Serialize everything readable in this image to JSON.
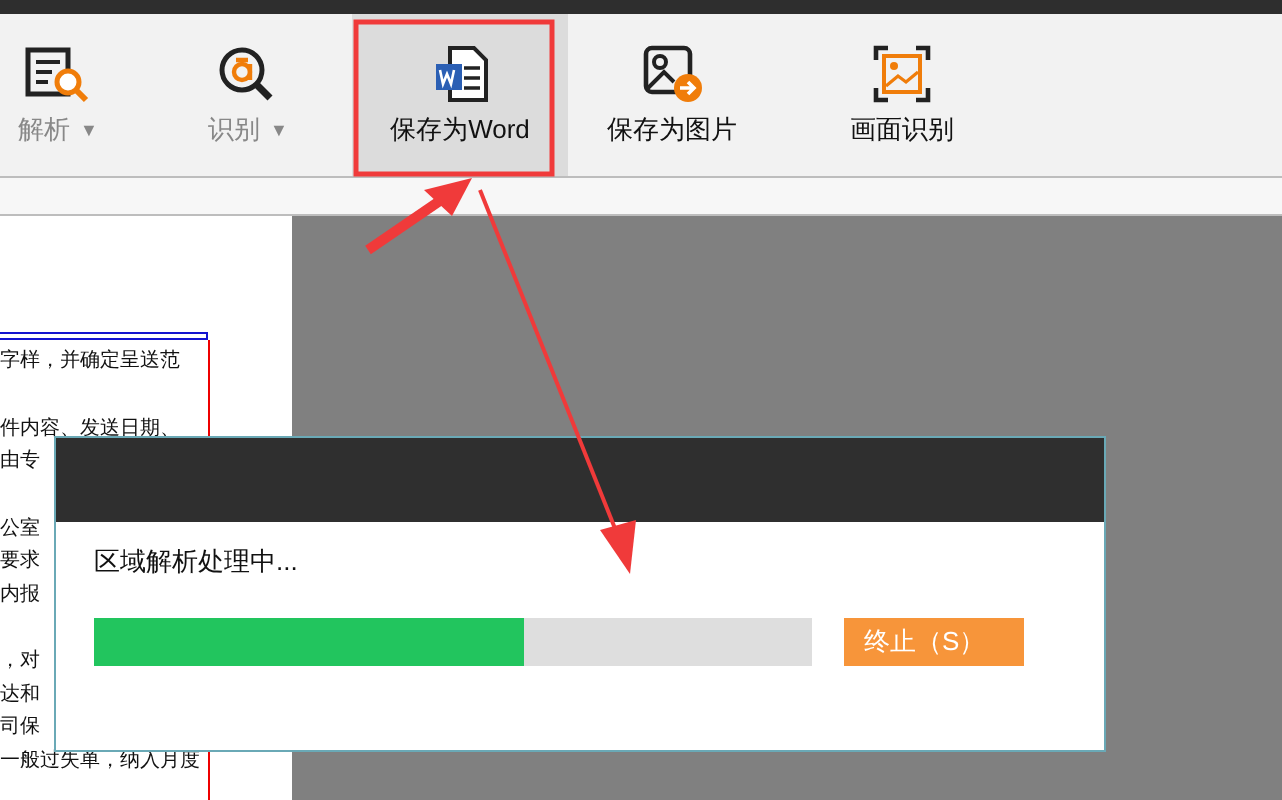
{
  "toolbar": {
    "items": [
      {
        "label": "解析",
        "caret": "▼",
        "selected": false
      },
      {
        "label": "识别",
        "caret": "▼",
        "selected": false
      },
      {
        "label": "保存为Word",
        "selected": true
      },
      {
        "label": "保存为图片",
        "selected": false
      },
      {
        "label": "画面识别",
        "selected": false
      }
    ]
  },
  "document": {
    "paragraphs": [
      {
        "lines": [
          "字样，并确定呈送范"
        ]
      },
      {
        "lines": [
          "件内容、发送日期、",
          "由专"
        ]
      },
      {
        "lines": [
          "公室",
          "要求",
          "内报"
        ]
      },
      {
        "lines": [
          "，对",
          "达和",
          "司保",
          "一般过失单，纳入月度"
        ]
      }
    ]
  },
  "dialog": {
    "message": "区域解析处理中...",
    "progress": {
      "level": 0.6
    },
    "button": "终止（S）"
  }
}
